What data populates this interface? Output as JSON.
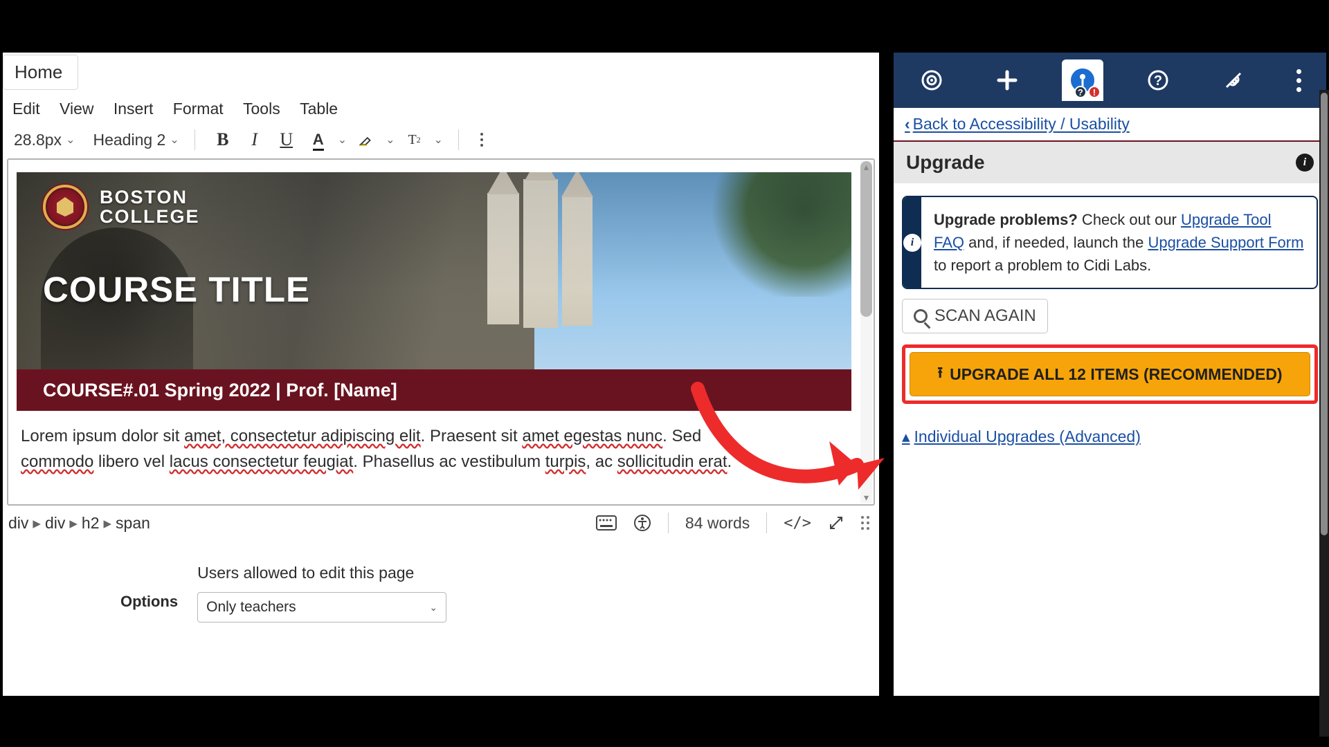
{
  "page": {
    "title_input": "Home"
  },
  "menubar": [
    "Edit",
    "View",
    "Insert",
    "Format",
    "Tools",
    "Table"
  ],
  "toolbar": {
    "font_size": "28.8px",
    "block_format": "Heading 2"
  },
  "content": {
    "institution_line1": "BOSTON",
    "institution_line2": "COLLEGE",
    "course_title": "COURSE TITLE",
    "course_sub": "COURSE#.01 Spring 2022 | Prof. [Name]",
    "para1_a": "Lorem ipsum dolor sit ",
    "para1_b_wavy": "amet, consectetur adipiscing elit",
    "para1_c": ". Praesent sit ",
    "para1_d_wavy": "amet egestas nunc",
    "para1_e": ". Sed ",
    "para2_a_wavy": "commodo",
    "para2_b": " libero vel ",
    "para2_c_wavy": "lacus consectetur feugiat",
    "para2_d": ". Phasellus ac vestibulum ",
    "para2_e_wavy": "turpis",
    "para2_f": ", ac ",
    "para2_g_wavy": "sollicitudin erat",
    "para2_h": "."
  },
  "status": {
    "crumb1": "div",
    "crumb2": "div",
    "crumb3": "h2",
    "crumb4": "span",
    "word_count": "84 words"
  },
  "options": {
    "label": "Options",
    "field_label": "Users allowed to edit this page",
    "select_value": "Only teachers"
  },
  "sidebar": {
    "backlink": "Back to Accessibility / Usability",
    "panel_title": "Upgrade",
    "callout_bold": "Upgrade problems?",
    "callout_mid1": " Check out our ",
    "callout_link1": "Upgrade Tool FAQ",
    "callout_mid2": " and, if needed, launch the ",
    "callout_link2": "Upgrade Support Form",
    "callout_tail": " to report a problem to Cidi Labs.",
    "scan_again": "SCAN AGAIN",
    "upgrade_all": "UPGRADE ALL 12 ITEMS (RECOMMENDED)",
    "advanced": " Individual Upgrades (Advanced)"
  }
}
